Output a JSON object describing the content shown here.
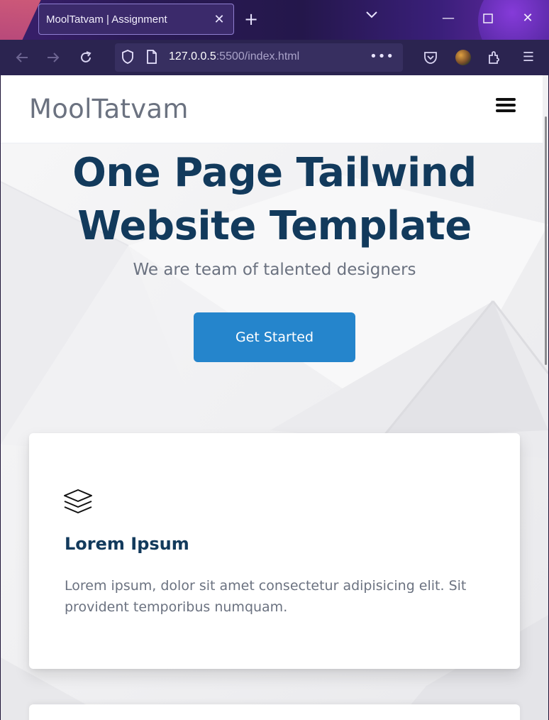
{
  "browser": {
    "tab_title": "MoolTatvam | Assignment",
    "url_host": "127.0.0.5",
    "url_rest": ":5500/index.html",
    "icons": [
      "back-arrow-icon",
      "forward-arrow-icon",
      "reload-icon",
      "shield-icon",
      "page-icon",
      "more-icon",
      "pocket-icon",
      "account-icon",
      "extensions-icon",
      "menu-icon"
    ]
  },
  "site": {
    "brand": "MoolTatvam",
    "hero": {
      "title": "One Page Tailwind Website Template",
      "subtitle": "We are team of talented designers",
      "cta": "Get Started"
    },
    "features": [
      {
        "icon": "layers-icon",
        "title": "Lorem Ipsum",
        "text": "Lorem ipsum, dolor sit amet consectetur adipisicing elit. Sit provident temporibus numquam."
      }
    ]
  },
  "colors": {
    "heading": "#123a5c",
    "muted": "#6b7280",
    "cta": "#2585cc",
    "browser_bg": "#2b2450"
  }
}
